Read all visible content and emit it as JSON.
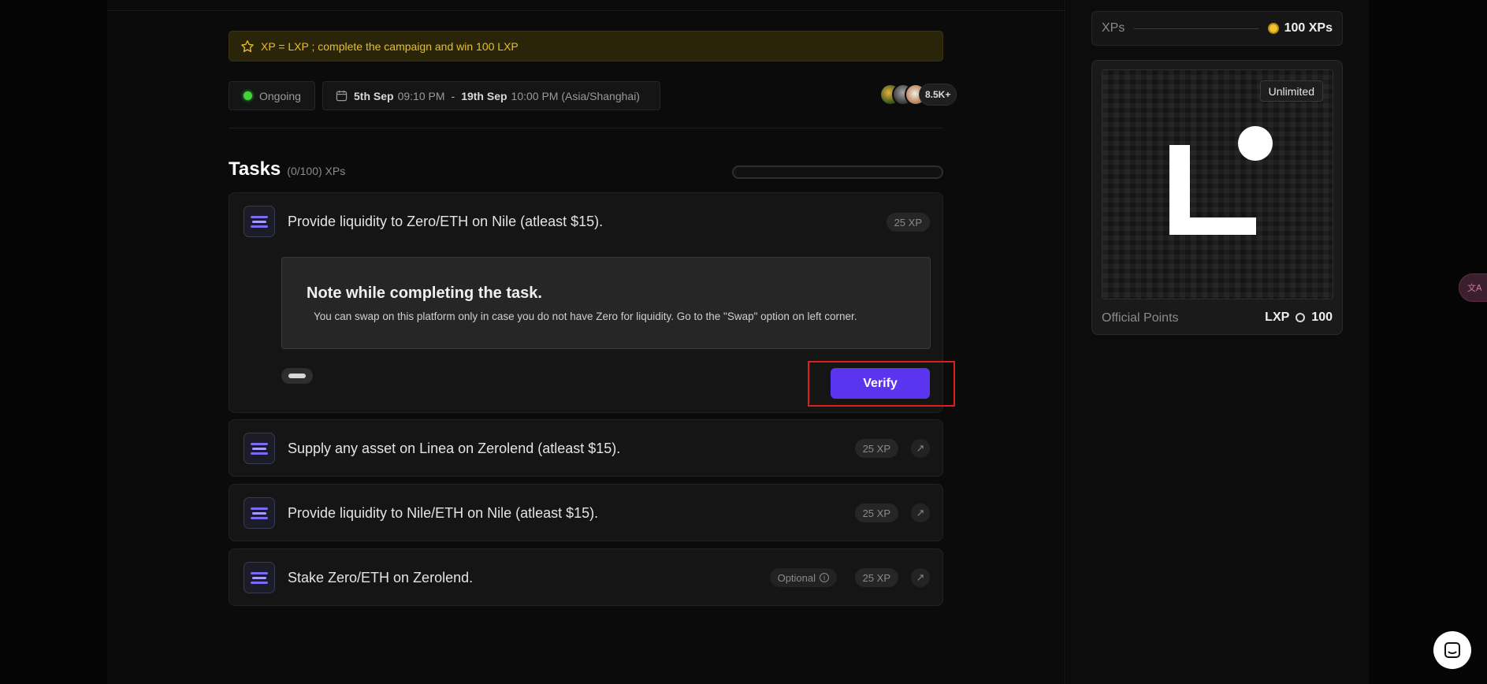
{
  "banner": {
    "text": "XP = LXP ; complete the campaign and win 100 LXP"
  },
  "status": {
    "label": "Ongoing"
  },
  "dates": {
    "start_day": "5th Sep",
    "start_time": "09:10 PM",
    "separator": "-",
    "end_day": "19th Sep",
    "end_time": "10:00 PM (Asia/Shanghai)"
  },
  "participants": {
    "count": "8.5K+"
  },
  "tasks": {
    "title": "Tasks",
    "progress_label": "(0/100) XPs",
    "progress_fraction": 0,
    "items": [
      {
        "title": "Provide liquidity to Zero/ETH on Nile (atleast $15).",
        "xp": "25 XP"
      },
      {
        "title": "Supply any asset on Linea on Zerolend (atleast $15).",
        "xp": "25 XP",
        "arrow": "↗"
      },
      {
        "title": "Provide liquidity to Nile/ETH on Nile (atleast $15).",
        "xp": "25 XP",
        "arrow": "↗"
      },
      {
        "title": "Stake Zero/ETH on Zerolend.",
        "xp": "25 XP",
        "optional": "Optional",
        "arrow": "↗"
      }
    ]
  },
  "note": {
    "title": "Note while completing the task.",
    "text": "You can swap on this platform only in case you do not have Zero for liquidity. Go to the \"Swap\" option on left corner."
  },
  "verify": {
    "label": "Verify",
    "accent": "#5b34ef",
    "highlight_color": "#e01d1d"
  },
  "sidebar": {
    "xps_label": "XPs",
    "xps_value": "100 XPs",
    "badge": "Unlimited",
    "points_label": "Official Points",
    "points_currency": "LXP",
    "points_value": "100"
  }
}
